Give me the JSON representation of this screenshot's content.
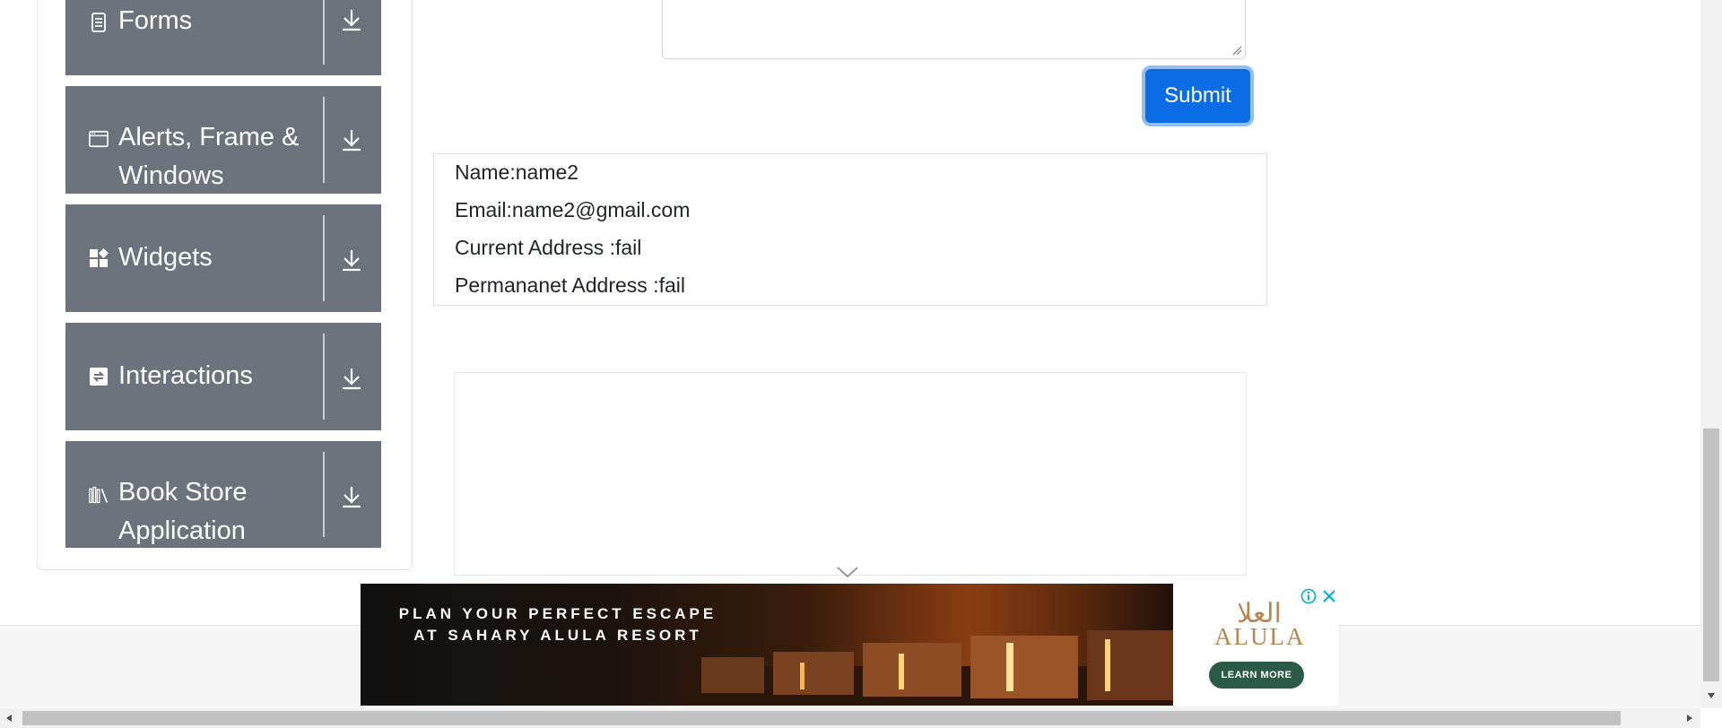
{
  "sidebar": {
    "groups": [
      {
        "label": "Forms",
        "icon": "document-icon"
      },
      {
        "label": "Alerts, Frame & Windows",
        "icon": "window-icon"
      },
      {
        "label": "Widgets",
        "icon": "widgets-icon"
      },
      {
        "label": "Interactions",
        "icon": "interactions-icon"
      },
      {
        "label": "Book Store Application",
        "icon": "books-icon"
      }
    ]
  },
  "form": {
    "submit_label": "Submit"
  },
  "output": {
    "name": "Name:name2",
    "email": "Email:name2@gmail.com",
    "current_address": "Current Address :fail",
    "permanent_address": "Permananet Address :fail"
  },
  "ad": {
    "headline_line1": "PLAN YOUR PERFECT ESCAPE",
    "headline_line2": "AT SAHARY ALULA RESORT",
    "brand_arabic": "العلا",
    "brand": "ALULA",
    "cta": "LEARN MORE"
  },
  "colors": {
    "accordion_bg": "#6c737c",
    "submit_bg": "#0b6de3",
    "ad_cta_bg": "#2b5a46",
    "ad_brand": "#b8844f"
  }
}
